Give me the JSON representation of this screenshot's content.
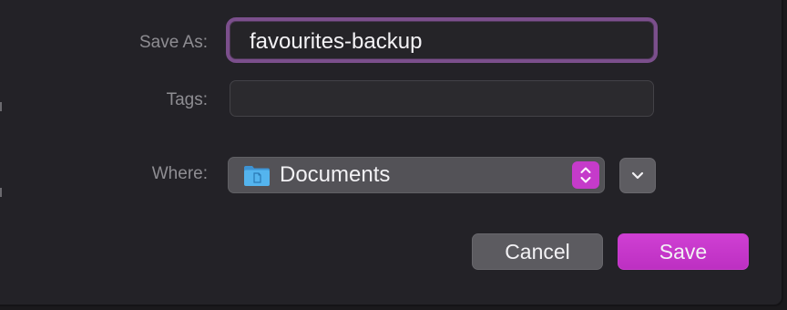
{
  "dialog": {
    "save_as_label": "Save As:",
    "filename_value": "favourites-backup",
    "tags_label": "Tags:",
    "tags_value": "",
    "where_label": "Where:",
    "where_value": "Documents",
    "cancel_label": "Cancel",
    "save_label": "Save"
  },
  "icons": {
    "folder": "folder-icon",
    "stepper": "up-down-chevron-icon",
    "expand": "chevron-down-icon"
  },
  "colors": {
    "accent": "#c53bca",
    "focus_ring": "#7b4f8c",
    "folder": "#4aa9e8"
  }
}
